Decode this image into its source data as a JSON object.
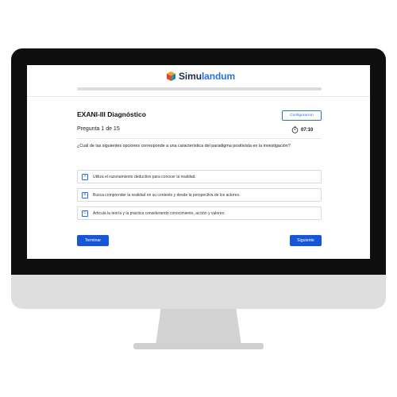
{
  "brand": {
    "name_part1": "Simu",
    "name_part2": "landum",
    "logo_icon": "cube-logo-icon"
  },
  "progress": {
    "fraction": 0.0
  },
  "exam": {
    "title": "EXANI-III Diagnóstico",
    "config_label": "Configuracion"
  },
  "question": {
    "counter": "Pregunta 1 de 15",
    "timer": "07:10",
    "text": "¿Cuál de las siguientes opciones corresponde a una característica del paradigma positivista en la investigación?"
  },
  "options": [
    {
      "letter": "A",
      "text": "Utiliza el razonamiento deductivo para conocer la realidad."
    },
    {
      "letter": "B",
      "text": "Busca comprender la realidad en su contexto y desde la perspectiva de los actores."
    },
    {
      "letter": "C",
      "text": "Articula la teoría y la práctica considerando conocimiento, acción y valores."
    }
  ],
  "actions": {
    "terminar_label": "Terminar",
    "siguiente_label": "Siguiente"
  },
  "colors": {
    "accent": "#2a6fdc",
    "primary_button": "#1756d6",
    "brand_dark": "#1c2b4a"
  }
}
